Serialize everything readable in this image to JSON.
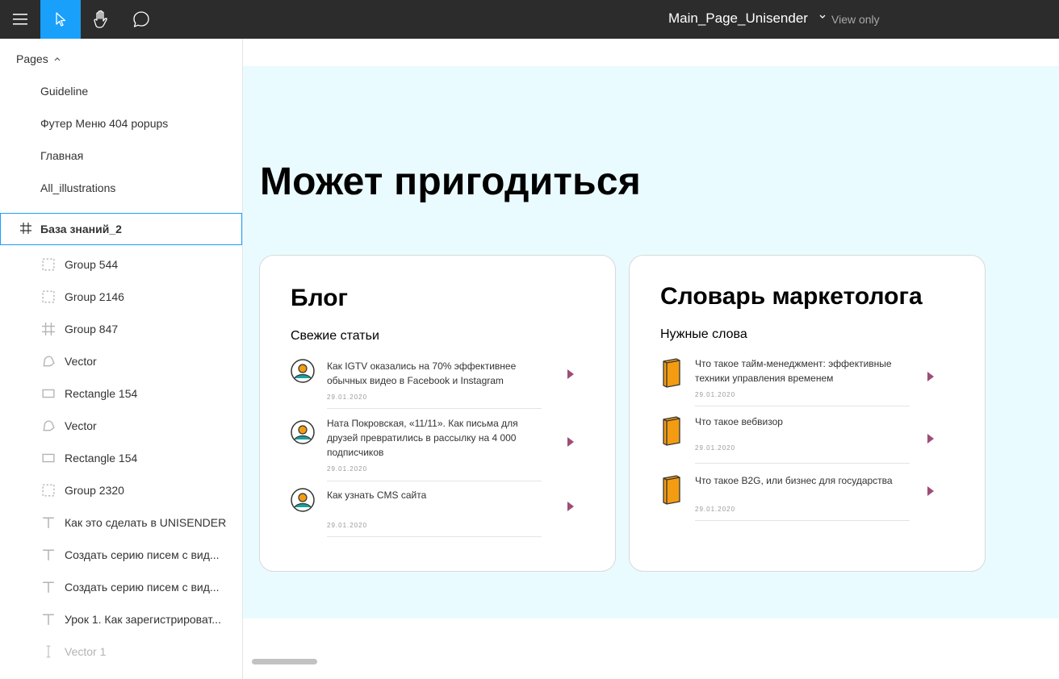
{
  "topbar": {
    "title": "Main_Page_Unisender",
    "view_only": "View only",
    "icons": [
      "menu-icon",
      "move-cursor-icon",
      "hand-icon",
      "comment-icon"
    ]
  },
  "sidebar": {
    "pages_label": "Pages",
    "pages": [
      "Guideline",
      "Футер Меню 404 popups",
      "Главная",
      "All_illustrations"
    ],
    "frame": "База знаний_2",
    "layers": [
      {
        "type": "group",
        "label": "Group 544"
      },
      {
        "type": "group",
        "label": "Group 2146"
      },
      {
        "type": "frame",
        "label": "Group 847"
      },
      {
        "type": "vector",
        "label": "Vector"
      },
      {
        "type": "rectangle",
        "label": "Rectangle 154"
      },
      {
        "type": "vector",
        "label": "Vector"
      },
      {
        "type": "rectangle",
        "label": "Rectangle 154"
      },
      {
        "type": "group",
        "label": "Group 2320"
      },
      {
        "type": "text",
        "label": "Как это сделать в UNISENDER"
      },
      {
        "type": "text",
        "label": "Создать серию писем с вид..."
      },
      {
        "type": "text",
        "label": "Создать серию писем с вид..."
      },
      {
        "type": "text",
        "label": "Урок 1. Как зарегистрироват..."
      },
      {
        "type": "line",
        "label": "Vector 1"
      }
    ]
  },
  "canvas": {
    "heading": "Может пригодиться",
    "blog": {
      "title": "Блог",
      "subtitle": "Свежие статьи",
      "items": [
        {
          "text": "Как IGTV оказались на 70% эффективнее обычных видео в Facebook и Instagram",
          "date": "29.01.2020"
        },
        {
          "text": "Ната Покровская, «11/11». Как письма для друзей превратились в рассылку на 4 000 подписчиков",
          "date": "29.01.2020"
        },
        {
          "text": "Как узнать CMS сайта",
          "date": "29.01.2020"
        }
      ]
    },
    "dictionary": {
      "title": "Словарь маркетолога",
      "subtitle": "Нужные слова",
      "items": [
        {
          "text": "Что такое тайм-менеджмент: эффективные техники управления временем",
          "date": "29.01.2020"
        },
        {
          "text": "Что такое вебвизор",
          "date": "29.01.2020"
        },
        {
          "text": "Что такое B2G, или бизнес для государства",
          "date": "29.01.2020"
        }
      ]
    }
  },
  "colors": {
    "topbar_bg": "#2c2c2c",
    "accent": "#18a0fb",
    "artboard_bg": "#e9fbff",
    "arrow": "#9c4e77",
    "book": "#f39c12"
  }
}
